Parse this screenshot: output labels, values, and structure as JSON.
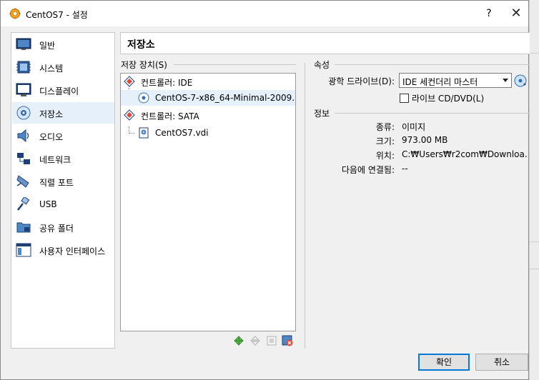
{
  "window": {
    "title": "CentOS7 - 설정",
    "help_label": "?",
    "close_label": "✕"
  },
  "sidebar": {
    "items": [
      {
        "label": "일반",
        "icon": "general-icon"
      },
      {
        "label": "시스템",
        "icon": "system-icon"
      },
      {
        "label": "디스플레이",
        "icon": "display-icon"
      },
      {
        "label": "저장소",
        "icon": "storage-icon",
        "selected": true
      },
      {
        "label": "오디오",
        "icon": "audio-icon"
      },
      {
        "label": "네트워크",
        "icon": "network-icon"
      },
      {
        "label": "직렬 포트",
        "icon": "serial-port-icon"
      },
      {
        "label": "USB",
        "icon": "usb-icon"
      },
      {
        "label": "공유 폴더",
        "icon": "shared-folder-icon"
      },
      {
        "label": "사용자 인터페이스",
        "icon": "user-interface-icon"
      }
    ]
  },
  "page": {
    "title": "저장소"
  },
  "storage": {
    "label": "저장 장치(S)",
    "tree": [
      {
        "label": "컨트롤러: IDE",
        "type": "controller"
      },
      {
        "label": "CentOS-7-x86_64-Minimal-2009....",
        "type": "optical",
        "selected": true
      },
      {
        "label": "컨트롤러: SATA",
        "type": "controller"
      },
      {
        "label": "CentOS7.vdi",
        "type": "disk"
      }
    ],
    "toolbar": [
      "add-controller-icon",
      "remove-controller-icon",
      "add-attachment-icon",
      "remove-attachment-icon"
    ]
  },
  "attributes": {
    "label": "속성",
    "optical_drive_label": "광학 드라이브(D):",
    "optical_drive_value": "IDE 세컨더리 마스터",
    "live_cd_label": "라이브 CD/DVD(L)",
    "live_cd_checked": false
  },
  "info": {
    "label": "정보",
    "rows": [
      {
        "key": "종류:",
        "value": "이미지"
      },
      {
        "key": "크기:",
        "value": "973.00 MB"
      },
      {
        "key": "위치:",
        "value": "C:₩Users₩r2com₩Downloa…"
      },
      {
        "key": "다음에 연결됨:",
        "value": "--"
      }
    ]
  },
  "buttons": {
    "ok": "확인",
    "cancel": "취소"
  },
  "colors": {
    "selection": "#e5f0fb",
    "default_button_border": "#0078d7"
  }
}
